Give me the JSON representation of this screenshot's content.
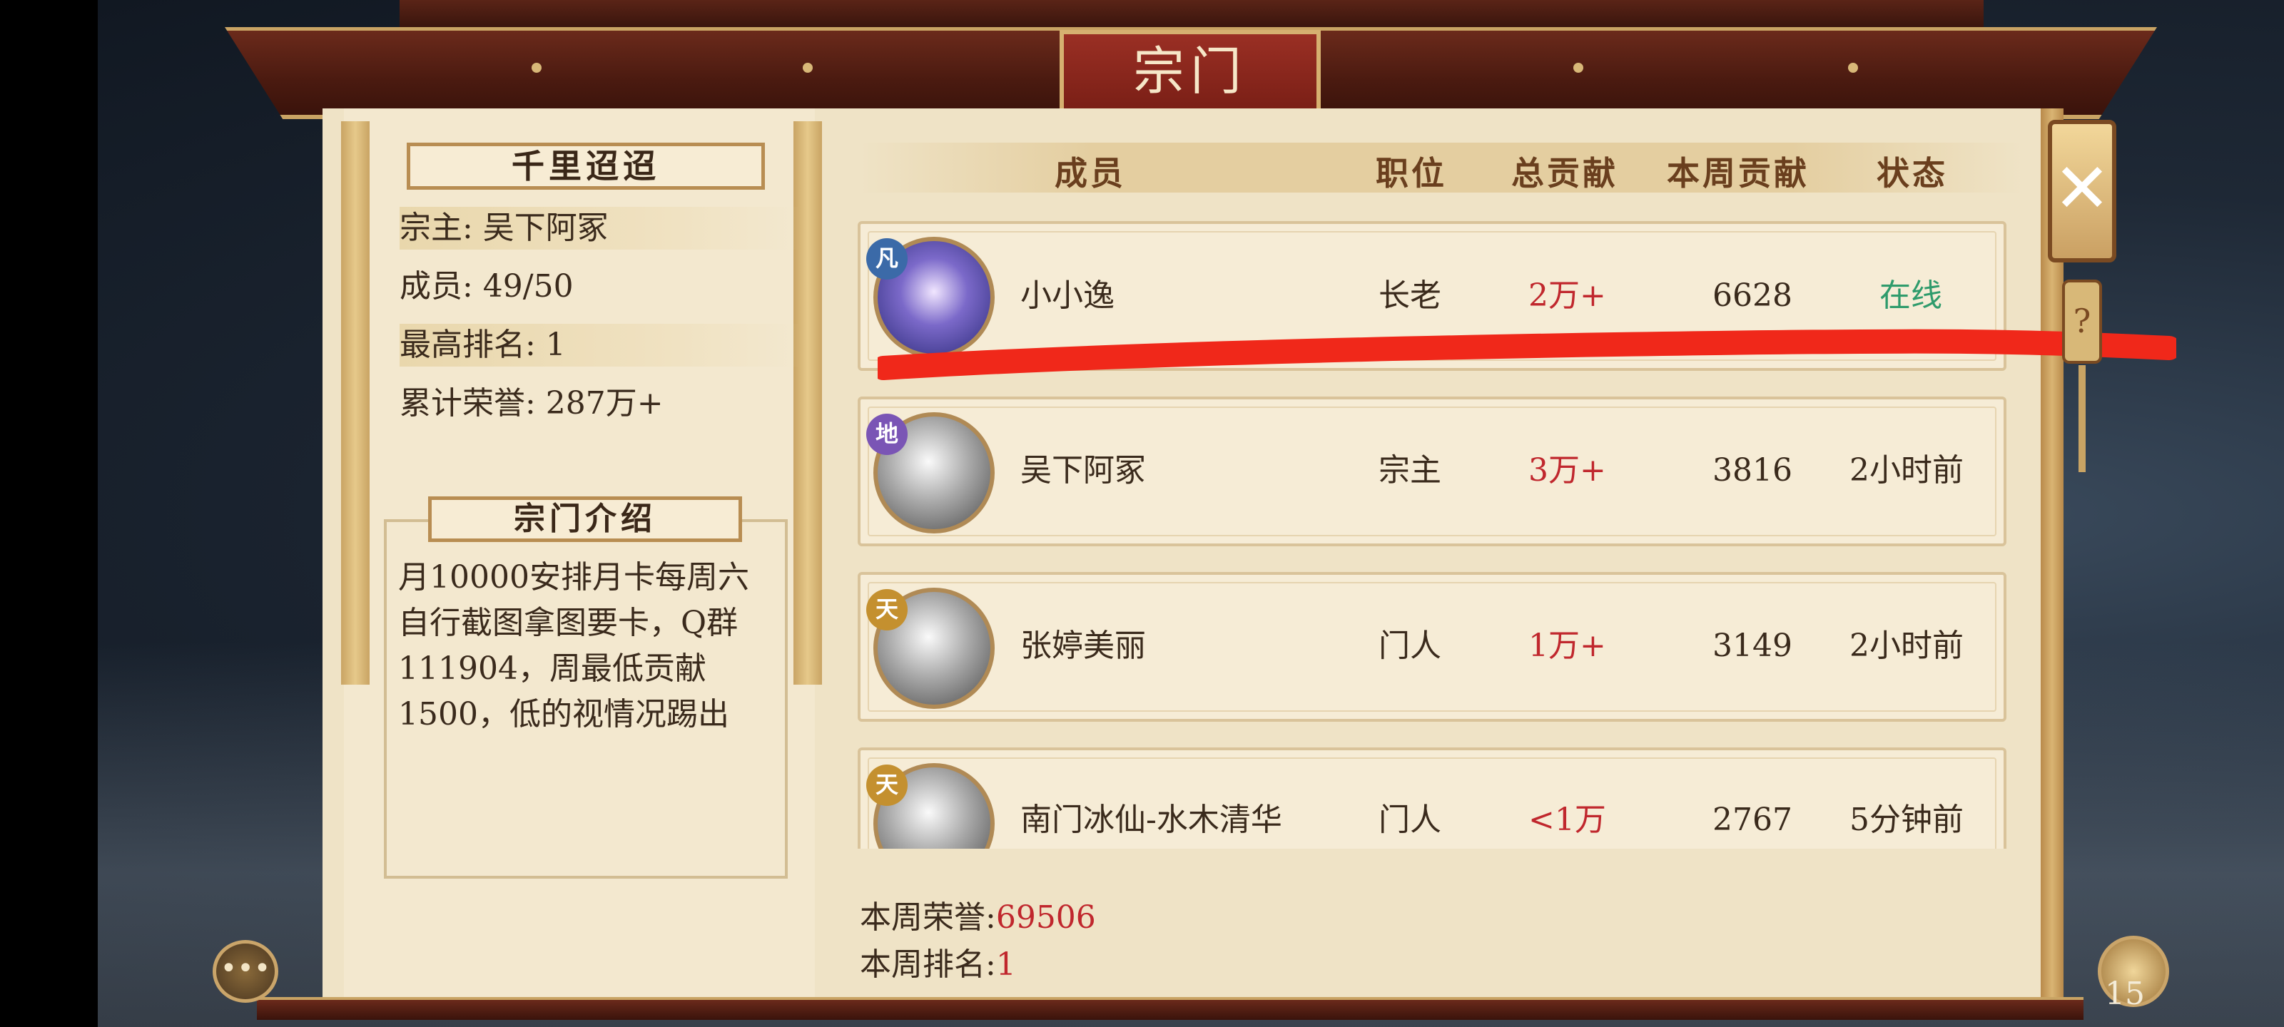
{
  "title": "宗门",
  "sect": {
    "name": "千里迢迢",
    "leader": "宗主: 吴下阿冢",
    "members": "成员: 49/50",
    "highest_rank": "最高排名: 1",
    "total_honor": "累计荣誉: 287万+",
    "intro_title": "宗门介绍",
    "intro_text": "月10000安排月卡每周六自行截图拿图要卡，Q群111904，周最低贡献1500，低的视情况踢出"
  },
  "table": {
    "headers": [
      "成员",
      "职位",
      "总贡献",
      "本周贡献",
      "状态"
    ],
    "rows": [
      {
        "name": "小小逸",
        "role": "长老",
        "total": "2万+",
        "weekly": "6628",
        "status": "在线",
        "badge": "凡"
      },
      {
        "name": "吴下阿冢",
        "role": "宗主",
        "total": "3万+",
        "weekly": "3816",
        "status": "2小时前",
        "badge": "地"
      },
      {
        "name": "张婷美丽",
        "role": "门人",
        "total": "1万+",
        "weekly": "3149",
        "status": "2小时前",
        "badge": "天"
      },
      {
        "name": "南门冰仙-水木清华",
        "role": "门人",
        "total": "<1万",
        "weekly": "2767",
        "status": "5分钟前",
        "badge": "天"
      }
    ]
  },
  "footer": {
    "weekly_honor_label": "本周荣誉:",
    "weekly_honor_value": "69506",
    "weekly_rank_label": "本周排名:",
    "weekly_rank_value": "1"
  },
  "widgets": {
    "close_glyph": "✕",
    "help_glyph": "?",
    "chat_glyph": "•••",
    "bag_count": "15"
  },
  "colors": {
    "accent_red": "#c0272d",
    "online_green": "#2f9b6c",
    "annotation_red": "#f0281a"
  }
}
